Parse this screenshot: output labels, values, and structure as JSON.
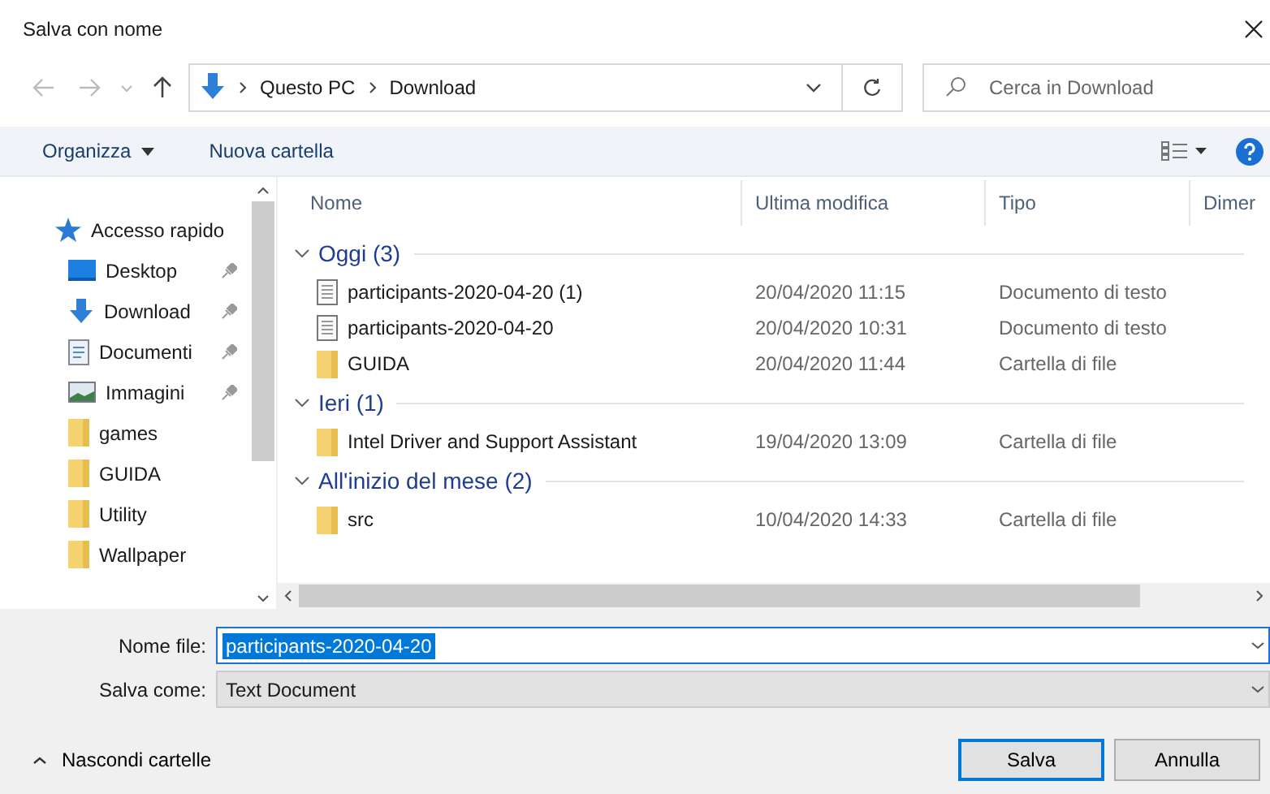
{
  "window": {
    "title": "Salva con nome"
  },
  "address_bar": {
    "path": [
      "Questo PC",
      "Download"
    ]
  },
  "search": {
    "placeholder": "Cerca in Download"
  },
  "toolbar": {
    "buttons": [
      "Organizza",
      "Nuova cartella"
    ]
  },
  "sidebar": {
    "items": [
      {
        "label": "Accesso rapido",
        "kind": "star",
        "pinned": false,
        "indent": false
      },
      {
        "label": "Desktop",
        "kind": "desktop",
        "pinned": true,
        "indent": true
      },
      {
        "label": "Download",
        "kind": "download",
        "pinned": true,
        "indent": true
      },
      {
        "label": "Documenti",
        "kind": "document",
        "pinned": true,
        "indent": true
      },
      {
        "label": "Immagini",
        "kind": "images",
        "pinned": true,
        "indent": true
      },
      {
        "label": "games",
        "kind": "folder",
        "pinned": false,
        "indent": true
      },
      {
        "label": "GUIDA",
        "kind": "folder",
        "pinned": false,
        "indent": true
      },
      {
        "label": "Utility",
        "kind": "folder",
        "pinned": false,
        "indent": true
      },
      {
        "label": "Wallpaper",
        "kind": "folder",
        "pinned": false,
        "indent": true
      }
    ]
  },
  "table": {
    "columns": [
      "Nome",
      "Ultima modifica",
      "Tipo",
      "Dimer"
    ],
    "groups": [
      {
        "label": "Oggi (3)",
        "expanded": true,
        "rows": [
          {
            "name": "participants-2020-04-20 (1)",
            "modified": "20/04/2020 11:15",
            "type": "Documento di testo",
            "kind": "text"
          },
          {
            "name": "participants-2020-04-20",
            "modified": "20/04/2020 10:31",
            "type": "Documento di testo",
            "kind": "text"
          },
          {
            "name": "GUIDA",
            "modified": "20/04/2020 11:44",
            "type": "Cartella di file",
            "kind": "folder"
          }
        ]
      },
      {
        "label": "Ieri (1)",
        "expanded": true,
        "rows": [
          {
            "name": "Intel Driver and Support Assistant",
            "modified": "19/04/2020 13:09",
            "type": "Cartella di file",
            "kind": "folder"
          }
        ]
      },
      {
        "label": "All'inizio del mese (2)",
        "expanded": true,
        "rows": [
          {
            "name": "src",
            "modified": "10/04/2020 14:33",
            "type": "Cartella di file",
            "kind": "folder"
          }
        ]
      }
    ]
  },
  "form": {
    "file_name_label": "Nome file:",
    "file_name": "participants-2020-04-20",
    "file_name_selected": true,
    "save_as_label": "Salva come:",
    "save_as": "Text Document"
  },
  "footer": {
    "toggle": "Nascondi cartelle",
    "buttons": [
      {
        "label": "Salva",
        "default": true
      },
      {
        "label": "Annulla",
        "default": false
      }
    ]
  }
}
